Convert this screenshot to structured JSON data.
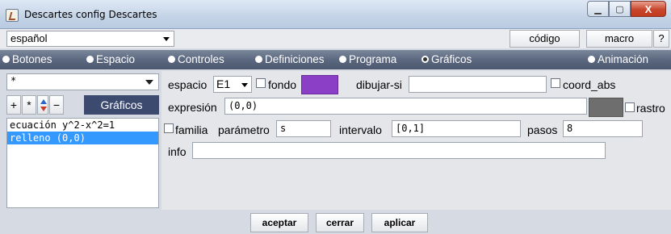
{
  "window": {
    "title": "Descartes config Descartes",
    "close_glyph": "X"
  },
  "top": {
    "language": "español",
    "codigo_label": "código",
    "macro_label": "macro",
    "help_label": "?"
  },
  "tabs": [
    {
      "label": "Botones",
      "selected": false
    },
    {
      "label": "Espacio",
      "selected": false
    },
    {
      "label": "Controles",
      "selected": false
    },
    {
      "label": "Definiciones",
      "selected": false
    },
    {
      "label": "Programa",
      "selected": false
    },
    {
      "label": "Gráficos",
      "selected": true
    },
    {
      "label": "Animación",
      "selected": false
    }
  ],
  "left": {
    "filter_value": "*",
    "tools": {
      "add": "+",
      "copy": "*",
      "remove": "−"
    },
    "section_label": "Gráficos",
    "items": [
      {
        "label": "ecuación y^2-x^2=1",
        "selected": false
      },
      {
        "label": "relleno (0,0)",
        "selected": true
      }
    ]
  },
  "graphic": {
    "espacio_label": "espacio",
    "espacio_value": "E1",
    "fondo_label": "fondo",
    "fondo_color": "#8b3fc6",
    "dibujar_si_label": "dibujar-si",
    "dibujar_si_value": "",
    "coord_abs_label": "coord_abs",
    "expresion_label": "expresión",
    "expresion_value": "(0,0)",
    "rastro_label": "rastro",
    "rastro_color": "#6e6e6e",
    "familia_label": "familia",
    "parametro_label": "parámetro",
    "parametro_value": "s",
    "intervalo_label": "intervalo",
    "intervalo_value": "[0,1]",
    "pasos_label": "pasos",
    "pasos_value": "8",
    "info_label": "info",
    "info_value": ""
  },
  "footer": {
    "aceptar_label": "aceptar",
    "cerrar_label": "cerrar",
    "aplicar_label": "aplicar"
  }
}
